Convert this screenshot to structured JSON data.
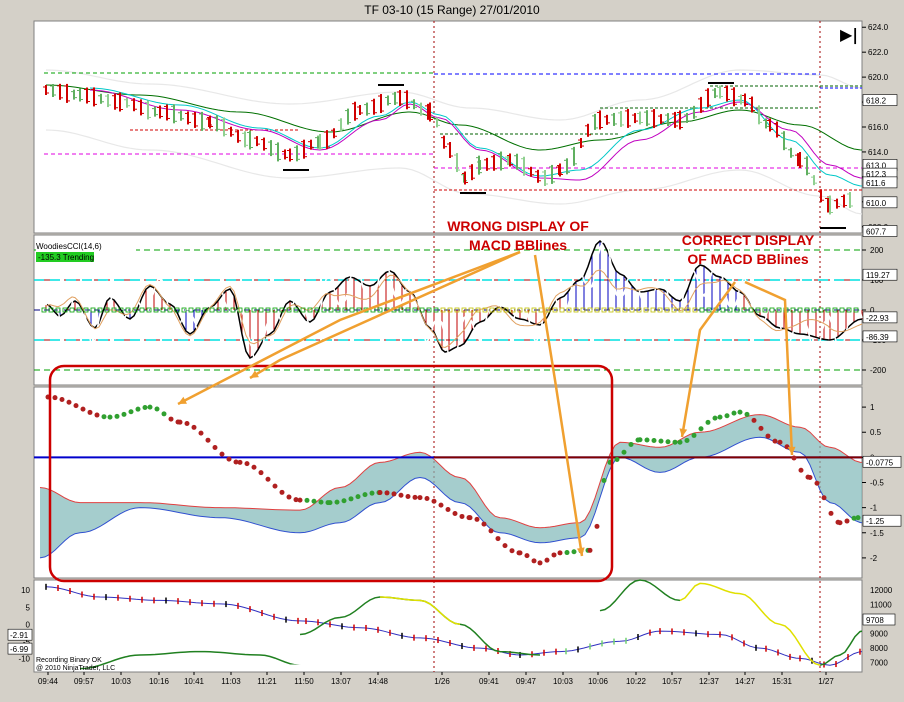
{
  "window": {
    "title": "TF 03-10 (15 Range)  27/01/2010"
  },
  "toolbar": {
    "end_button_glyph": "▶|"
  },
  "price_panel": {
    "axis_ticks": [
      "624.0",
      "622.0",
      "620.0",
      "618.0",
      "616.0",
      "614.0",
      "612.0",
      "610.0",
      "608.0"
    ],
    "axis_tick_values": [
      624,
      622,
      620,
      618,
      616,
      614,
      612,
      610,
      608
    ],
    "ylim": [
      607.5,
      624.5
    ],
    "price_tags": [
      {
        "label": "618.2",
        "value": 618.2,
        "color": "#ffffff",
        "text_color": "#000000"
      },
      {
        "label": "613.0",
        "value": 613.0,
        "color": "#ffffff",
        "text_color": "#000000"
      },
      {
        "label": "612.3",
        "value": 612.3,
        "color": "#ffffff",
        "text_color": "#000000"
      },
      {
        "label": "611.6",
        "value": 611.6,
        "color": "#ffffff",
        "text_color": "#000000"
      },
      {
        "label": "610.0",
        "value": 610.0,
        "color": "#ffffff",
        "text_color": "#000000"
      },
      {
        "label": "607.7",
        "value": 607.7,
        "color": "#ffffff",
        "text_color": "#000000"
      }
    ]
  },
  "cci_panel": {
    "indicator_label": "WoodiesCCI(14,6)",
    "status_badge": "-135.3 Trending",
    "axis_ticks": [
      "200",
      "100",
      "0",
      "-100",
      "-200"
    ],
    "axis_tick_values": [
      200,
      100,
      0,
      -100,
      -200
    ],
    "ylim": [
      -250,
      250
    ],
    "value_tags": [
      {
        "label": "119.27",
        "value": 119.27
      },
      {
        "label": "-22.93",
        "value": -22.93
      },
      {
        "label": "-86.39",
        "value": -86.39
      }
    ]
  },
  "macd_panel": {
    "axis_ticks": [
      "1",
      "0.5",
      "0",
      "-0.5",
      "-1",
      "-1.5",
      "-2"
    ],
    "axis_tick_values": [
      1,
      0.5,
      0,
      -0.5,
      -1,
      -1.5,
      -2
    ],
    "ylim": [
      -2.4,
      1.4
    ],
    "value_tags": [
      {
        "label": "-0.0775",
        "value": -0.0775
      },
      {
        "label": "-1.25",
        "value": -1.25
      }
    ]
  },
  "bottom_panel": {
    "left_ticks": [
      "10",
      "5",
      "0",
      "-5",
      "-10"
    ],
    "left_tick_values": [
      10,
      5,
      0,
      -5,
      -10
    ],
    "left_ylim": [
      -14,
      13
    ],
    "right_ticks": [
      "12000",
      "11000",
      "10000",
      "9000",
      "8000",
      "7000"
    ],
    "right_tick_values": [
      12000,
      11000,
      10000,
      9000,
      8000,
      7000
    ],
    "left_tags": [
      {
        "label": "-2.91",
        "value": -2.91
      },
      {
        "label": "-6.99",
        "value": -6.99
      }
    ],
    "right_tag": "9708",
    "footer_lines": [
      "Recording Binary OK",
      "@ 2010 NinjaTrader, LLC"
    ]
  },
  "time_axis": [
    "09:44",
    "09:57",
    "10:03",
    "10:16",
    "10:41",
    "11:03",
    "11:21",
    "11:50",
    "13:07",
    "14:48",
    "1/26",
    "09:41",
    "09:47",
    "10:03",
    "10:06",
    "10:22",
    "10:57",
    "12:37",
    "14:27",
    "15:31",
    "1/27"
  ],
  "annotations": {
    "wrong_line1": "WRONG DISPLAY OF",
    "wrong_line2": "MACD BBlines",
    "correct_line1": "CORRECT DISPLAY",
    "correct_line2": "OF MACD BBlines"
  },
  "colors": {
    "chart_bg": "#ffffff",
    "frame": "#d4d0c8",
    "annotation_red": "#cc0000",
    "arrow_orange": "#f0a030",
    "macd_zero": "#0000cc",
    "band_fill": "#7fb8b8",
    "dot_red": "#b02020",
    "dot_green": "#30a030"
  }
}
